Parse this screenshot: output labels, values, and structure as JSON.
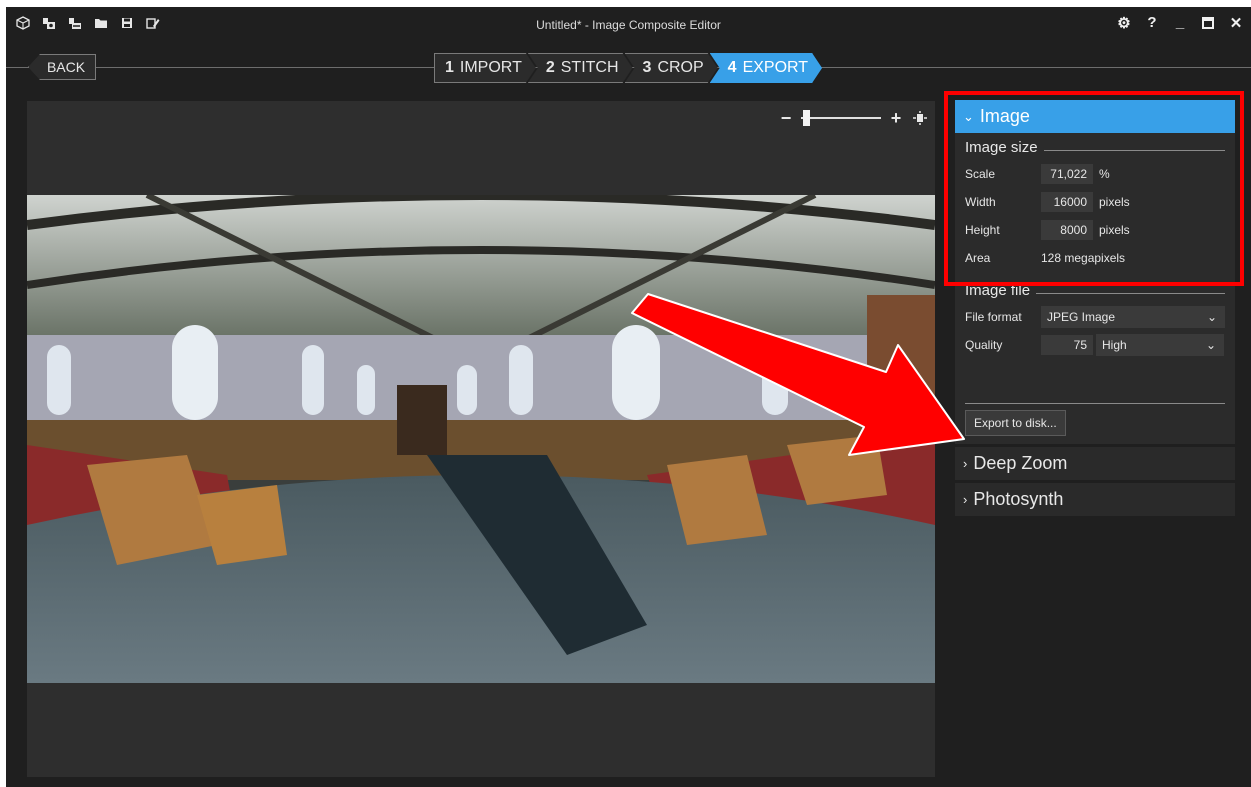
{
  "window": {
    "title": "Untitled* - Image Composite Editor",
    "toolbar_icons": [
      "new-project-icon",
      "new-panorama-icon",
      "new-stitch-icon",
      "open-folder-icon",
      "save-icon",
      "save-as-icon"
    ],
    "controls": {
      "settings": "⚙",
      "help": "?",
      "minimize": "_",
      "maximize": "▢",
      "close": "✕"
    }
  },
  "nav": {
    "back_label": "BACK",
    "steps": [
      {
        "num": "1",
        "label": "IMPORT"
      },
      {
        "num": "2",
        "label": "STITCH"
      },
      {
        "num": "3",
        "label": "CROP"
      },
      {
        "num": "4",
        "label": "EXPORT"
      }
    ],
    "active_step": 4
  },
  "viewer": {
    "zoom_out": "−",
    "zoom_in": "+",
    "fit_icon": "fit-to-window-icon",
    "zoom_level_fraction": 0.05
  },
  "panel": {
    "image_section": {
      "title": "Image",
      "image_size": {
        "heading": "Image size",
        "scale": {
          "label": "Scale",
          "value": "71,022",
          "unit": "%"
        },
        "width": {
          "label": "Width",
          "value": "16000",
          "unit": "pixels"
        },
        "height": {
          "label": "Height",
          "value": "8000",
          "unit": "pixels"
        },
        "area": {
          "label": "Area",
          "value": "128 megapixels"
        }
      },
      "image_file": {
        "heading": "Image file",
        "file_format": {
          "label": "File format",
          "value": "JPEG Image"
        },
        "quality": {
          "label": "Quality",
          "value": "75",
          "level": "High"
        }
      },
      "export_button": "Export to disk..."
    },
    "deep_zoom": {
      "title": "Deep Zoom"
    },
    "photosynth": {
      "title": "Photosynth"
    }
  },
  "colors": {
    "accent": "#38a0e8",
    "highlight": "#ff0000",
    "background": "#1f1f1f"
  }
}
